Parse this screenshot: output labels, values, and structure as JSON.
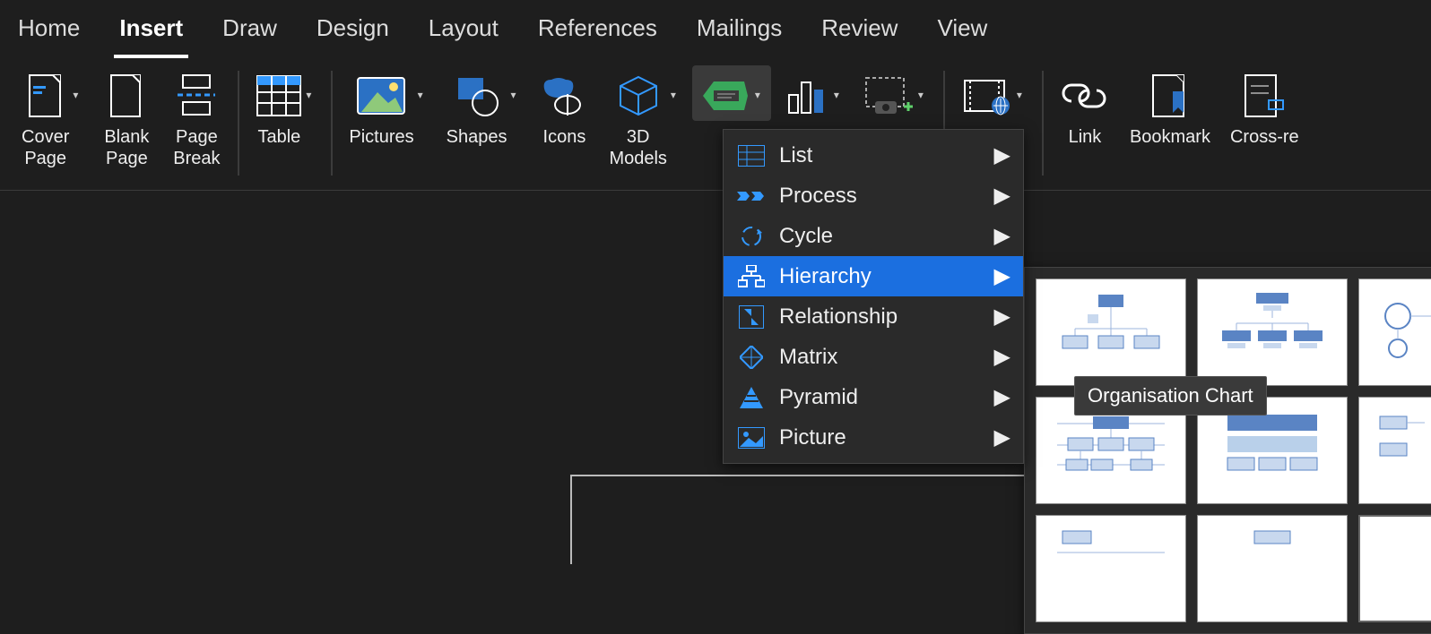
{
  "tabs": [
    "Home",
    "Insert",
    "Draw",
    "Design",
    "Layout",
    "References",
    "Mailings",
    "Review",
    "View"
  ],
  "active_tab": "Insert",
  "ribbon": {
    "coverPage": "Cover\nPage",
    "blankPage": "Blank\nPage",
    "pageBreak": "Page\nBreak",
    "table": "Table",
    "pictures": "Pictures",
    "shapes": "Shapes",
    "icons": "Icons",
    "models3d": "3D\nModels",
    "media": "Media",
    "link": "Link",
    "bookmark": "Bookmark",
    "crossref": "Cross-re"
  },
  "smartart_menu": [
    {
      "label": "List",
      "icon": "list"
    },
    {
      "label": "Process",
      "icon": "process"
    },
    {
      "label": "Cycle",
      "icon": "cycle"
    },
    {
      "label": "Hierarchy",
      "icon": "hierarchy",
      "highlight": true
    },
    {
      "label": "Relationship",
      "icon": "relationship"
    },
    {
      "label": "Matrix",
      "icon": "matrix"
    },
    {
      "label": "Pyramid",
      "icon": "pyramid"
    },
    {
      "label": "Picture",
      "icon": "picture"
    }
  ],
  "tooltip": "Organisation Chart"
}
